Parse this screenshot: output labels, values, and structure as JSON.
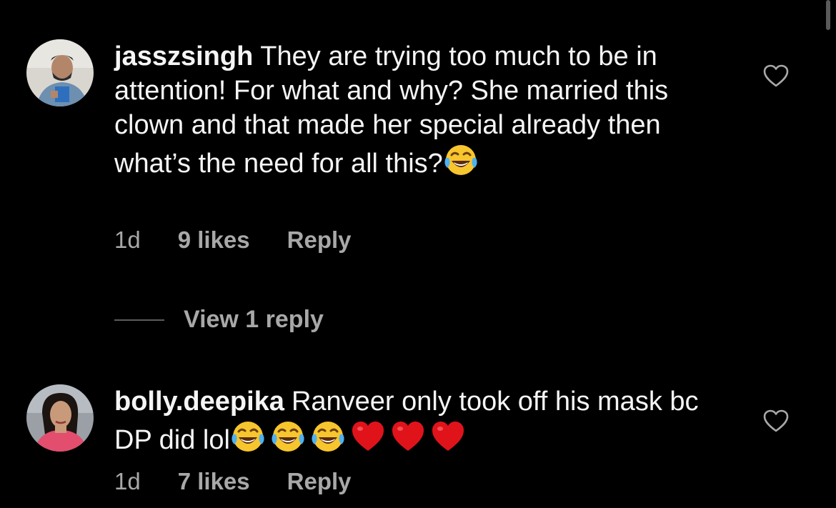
{
  "comments": [
    {
      "username": "jasszsingh",
      "text": "They are trying too much to be in attention! For what and why? She married this clown and that made her special already then what’s the need for all this?",
      "emojis": [
        "face-with-tears-of-joy-icon"
      ],
      "time": "1d",
      "likes": "9 likes",
      "reply_label": "Reply",
      "liked": false
    },
    {
      "username": "bolly.deepika",
      "text": "Ranveer only took off his mask bc DP did lol",
      "emojis": [
        "face-with-tears-of-joy-icon",
        "face-with-tears-of-joy-icon",
        "face-with-tears-of-joy-icon",
        "red-heart-icon",
        "red-heart-icon",
        "red-heart-icon"
      ],
      "time": "1d",
      "likes": "7 likes",
      "reply_label": "Reply",
      "liked": false
    }
  ],
  "view_replies_label": "View 1 reply",
  "colors": {
    "background": "#000000",
    "text": "#f5f5f5",
    "muted": "#a8a8a8",
    "heart_red": "#e0131b",
    "emoji_yellow": "#f7c62e"
  }
}
